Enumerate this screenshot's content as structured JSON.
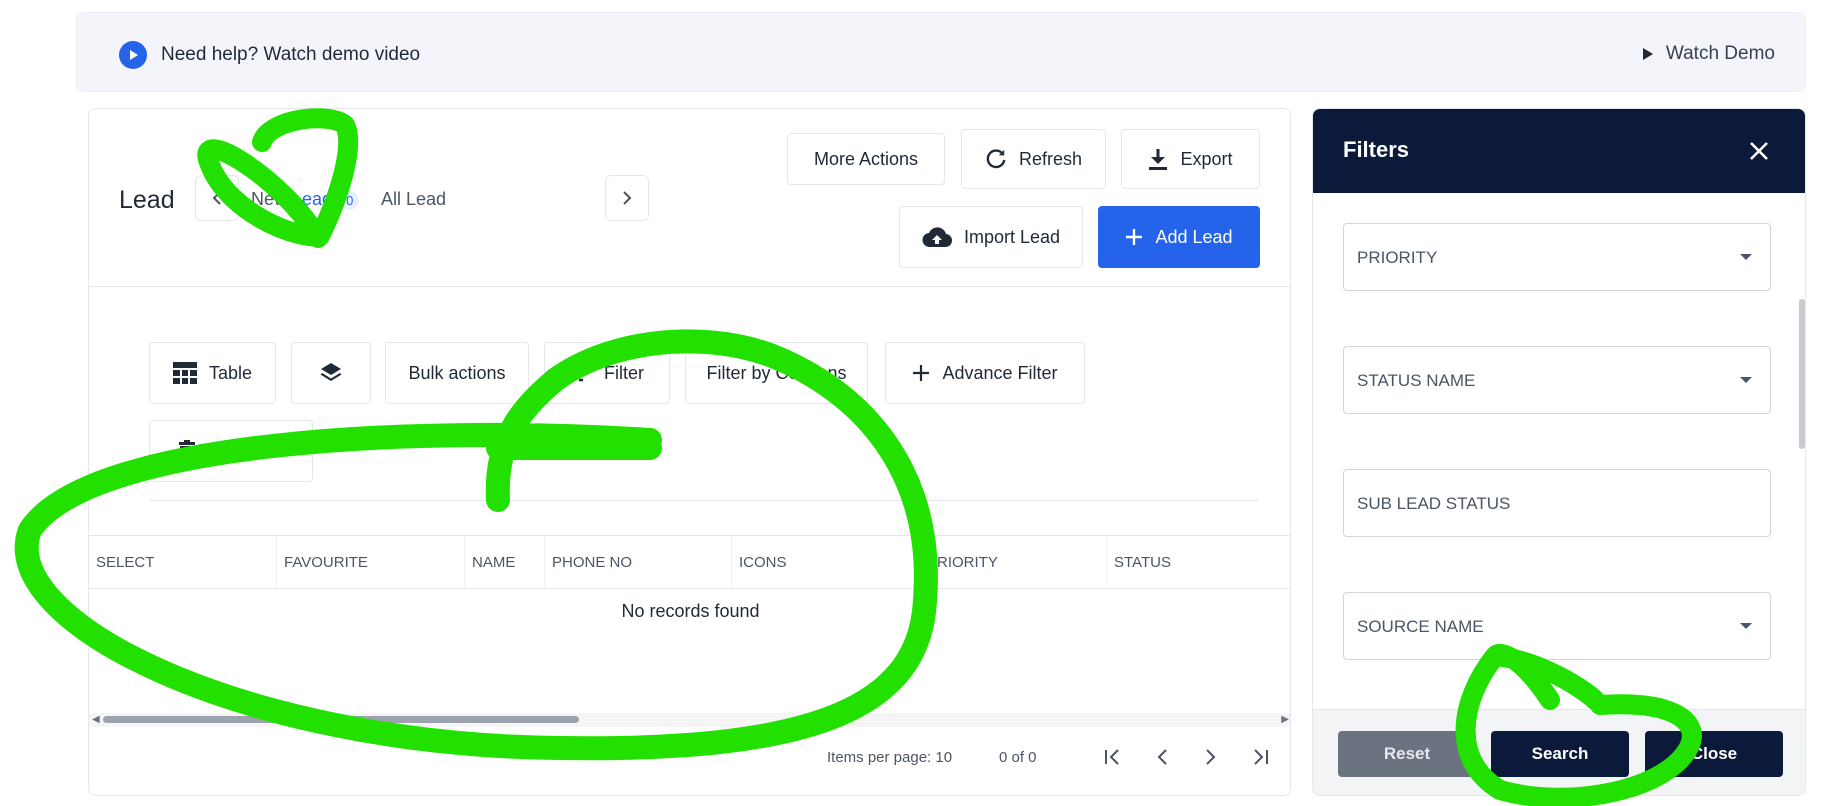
{
  "help_banner": {
    "text": "Need help? Watch demo video",
    "watch_demo": "Watch Demo"
  },
  "page": {
    "title": "Lead"
  },
  "tabs": {
    "new_lead_a": "New ",
    "new_lead_b": "Lead",
    "new_lead_count": "0",
    "all_lead": "All Lead"
  },
  "header_actions": {
    "more_actions": "More Actions",
    "refresh": "Refresh",
    "export": "Export",
    "import_lead": "Import Lead",
    "add_lead": "Add Lead"
  },
  "toolbar": {
    "table": "Table",
    "bulk_actions": "Bulk actions",
    "filter": "Filter",
    "filter_by_columns": "Filter by Columns",
    "advance_filter": "Advance Filter",
    "delete_all": "Delete All"
  },
  "table": {
    "columns": [
      "SELECT",
      "FAVOURITE",
      "NAME",
      "PHONE NO",
      "ICONS",
      "PRIORITY",
      "STATUS"
    ],
    "empty_text": "No records found"
  },
  "paginator": {
    "items_per_page_label": "Items per page:",
    "items_per_page": "10",
    "range": "0 of 0"
  },
  "filters": {
    "title": "Filters",
    "fields": [
      "PRIORITY",
      "STATUS NAME",
      "SUB LEAD STATUS",
      "SOURCE NAME"
    ],
    "reset": "Reset",
    "search": "Search",
    "close": "Close"
  },
  "colors": {
    "accent": "#2563eb",
    "panel_header": "#0b1a3a",
    "annotation": "#22e000"
  }
}
